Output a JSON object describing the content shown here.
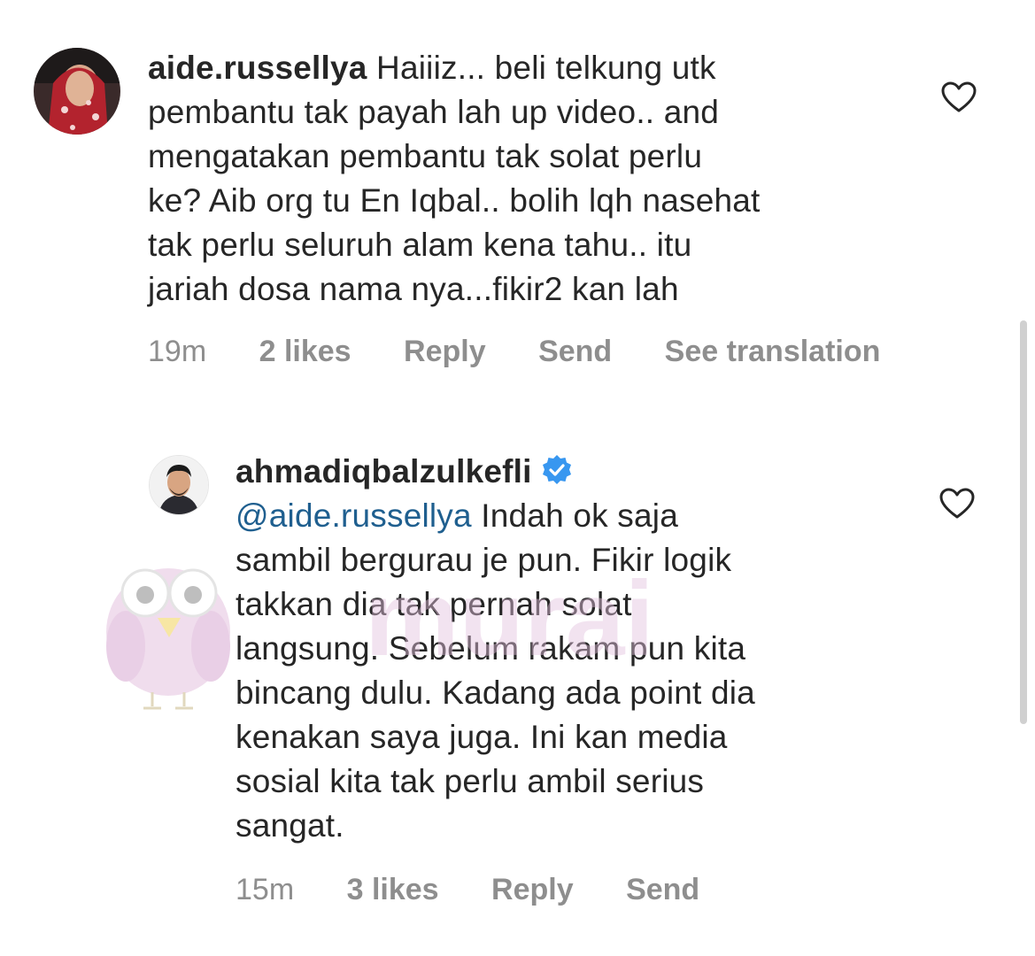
{
  "comments": [
    {
      "username": "aide.russellya",
      "text_lines": [
        " Haiiiz... beli telkung utk",
        "pembantu tak payah lah up video.. and",
        "mengatakan pembantu tak solat perlu",
        "ke? Aib org tu En Iqbal.. bolih lqh nasehat",
        "tak perlu seluruh alam kena tahu.. itu",
        "jariah dosa nama nya...fikir2 kan lah"
      ],
      "time": "19m",
      "likes": "2 likes",
      "reply": "Reply",
      "send": "Send",
      "translation": "See translation"
    },
    {
      "username": "ahmadiqbalzulkefli",
      "mention": "@aide.russellya",
      "text_lines": [
        " Indah ok saja",
        "sambil bergurau je pun. Fikir logik",
        "takkan dia tak pernah solat",
        "langsung. Sebelum rakam pun kita",
        "bincang dulu. Kadang ada point dia",
        "kenakan saya juga. Ini kan media",
        "sosial kita tak perlu ambil serius",
        "sangat."
      ],
      "time": "15m",
      "likes": "3 likes",
      "reply": "Reply",
      "send": "Send"
    }
  ],
  "icons": {
    "like": "heart-outline-icon",
    "verified": "verified-badge-icon"
  },
  "watermark_text": "murai",
  "colors": {
    "text": "#262626",
    "meta": "#8e8e8e",
    "mention": "#1f5f8f",
    "verified": "#3897f0",
    "watermark": "#e4c2df"
  }
}
